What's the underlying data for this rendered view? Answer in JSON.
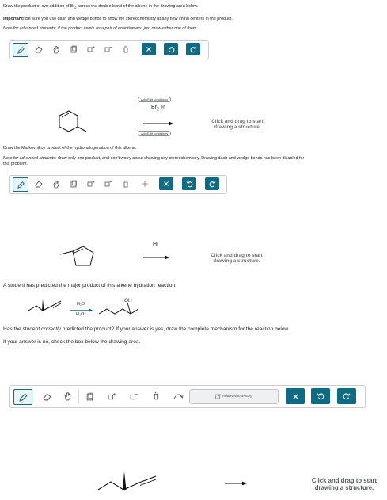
{
  "q1": {
    "line1_a": "Draw the product of ",
    "line1_syn": "syn",
    "line1_b": " addition of Br",
    "line1_sub": "2",
    "line1_c": " across the double bond of the alkene in the drawing area below.",
    "important_label": "Important!",
    "important_text": " Be sure you use dash and wedge bonds to show the stereochemistry at any new chiral centers in the product.",
    "note_text": "Note for advanced students: if the product exists as a pair of enantiomers, just draw either one of them.",
    "reagent": "Br",
    "reagent_sub": "2",
    "add_conditions_top": "Add/Edit conditions",
    "add_conditions_bottom": "Add/Edit conditions",
    "hint_line1": "Click and drag to start",
    "hint_line2": "drawing a structure."
  },
  "q2": {
    "line1": "Draw the Markovnikov product of the hydrohalogenation of this alkene.",
    "note_label": "Note for advanced students:",
    "note_text": " draw only one product, and don't worry about showing any stereochemistry. Drawing dash and wedge bonds has been disabled for",
    "note_text2": "this problem.",
    "reagent": "HI",
    "hint_line1": "Click and drag to start",
    "hint_line2": "drawing a structure."
  },
  "q3": {
    "intro": "A student has predicted the major product of this alkene hydration reaction:",
    "reagent_top": "H₂O",
    "reagent_bottom": "H₃O⁺",
    "product_label": "OH",
    "question_a": "Has the student ",
    "question_em": "correctly",
    "question_b": " predicted the product? If your answer is ",
    "question_yes": "yes",
    "question_c": ", draw the complete mechanism for the reaction below.",
    "if_no": "If your answer is no, check the box below the drawing area.",
    "add_step": "Add/Remove step",
    "hint_line1": "Click and drag to start",
    "hint_line2": "drawing a structure."
  },
  "toolbar_icons": [
    "pencil-icon",
    "eraser-icon",
    "hand-icon",
    "template-icon",
    "charge-plus-icon",
    "charge-minus-icon",
    "lone-pair-icon",
    "close-icon",
    "undo-icon",
    "redo-icon"
  ],
  "colors": {
    "accent": "#0f6a83",
    "accent_light": "#e9f4f7",
    "border": "#c9ccd1",
    "hint": "#6d737a"
  }
}
